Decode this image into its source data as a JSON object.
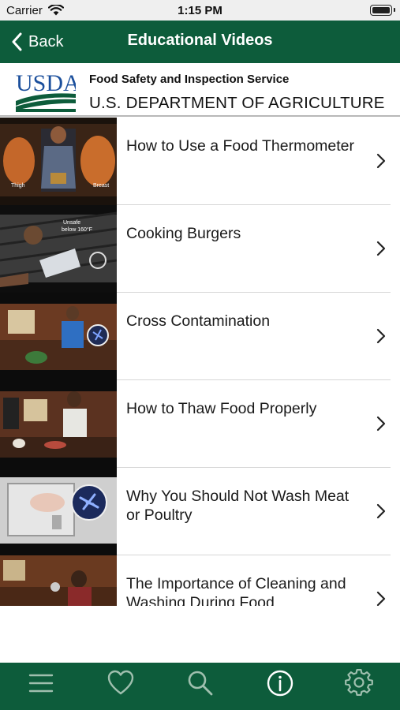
{
  "status_bar": {
    "carrier": "Carrier",
    "time": "1:15 PM"
  },
  "nav": {
    "back_label": "Back",
    "title": "Educational Videos"
  },
  "banner": {
    "logo_text": "USDA",
    "agency": "Food Safety and Inspection Service",
    "department": "U.S. DEPARTMENT OF AGRICULTURE"
  },
  "videos": [
    {
      "title": "How to Use a Food Thermometer",
      "thumb_labels": [
        "Thigh",
        "Breast"
      ]
    },
    {
      "title": "Cooking Burgers",
      "thumb_labels": [
        "Unsafe",
        "below 160°F"
      ]
    },
    {
      "title": "Cross Contamination"
    },
    {
      "title": "How to Thaw Food Properly"
    },
    {
      "title": "Why You Should Not Wash Meat or Poultry"
    },
    {
      "title": "The Importance of Cleaning and Washing During Food"
    }
  ],
  "tab_bar": {
    "items": [
      {
        "icon": "menu-icon"
      },
      {
        "icon": "heart-icon"
      },
      {
        "icon": "search-icon"
      },
      {
        "icon": "info-icon",
        "active": true
      },
      {
        "icon": "gear-icon"
      }
    ]
  },
  "colors": {
    "brand_green": "#0d5c3b",
    "separator": "#d6d6d6"
  }
}
